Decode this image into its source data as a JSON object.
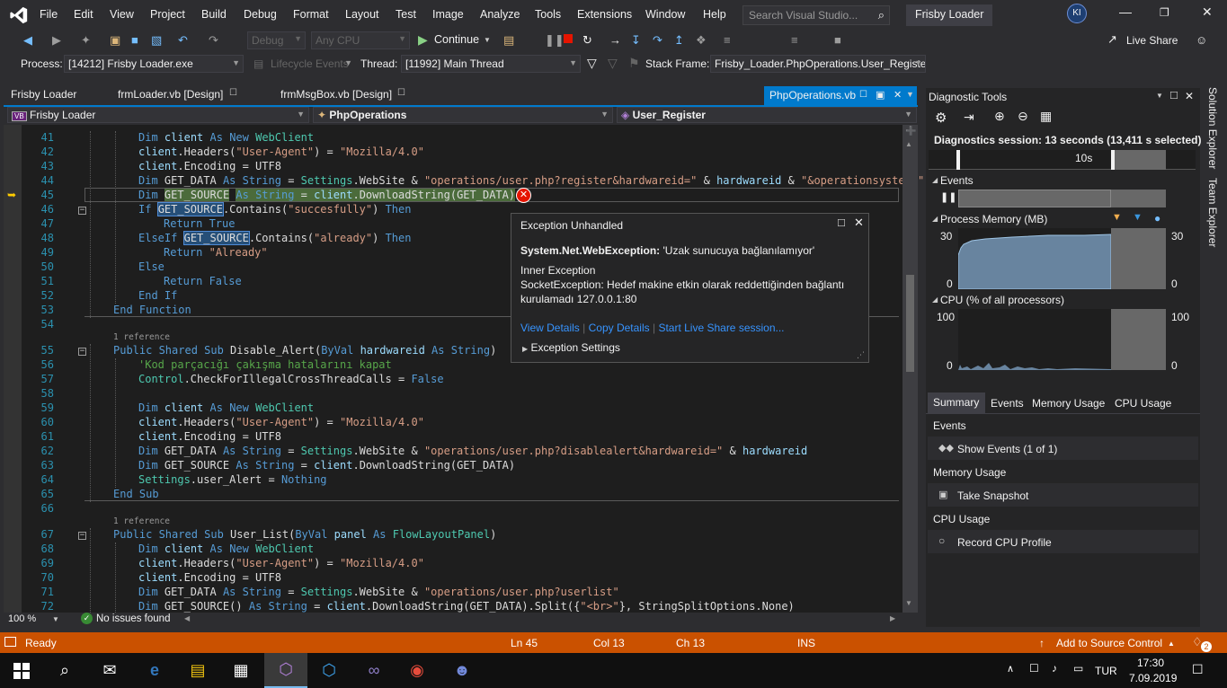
{
  "menu": {
    "items": [
      "File",
      "Edit",
      "View",
      "Project",
      "Build",
      "Debug",
      "Format",
      "Layout",
      "Test",
      "Image",
      "Analyze",
      "Tools",
      "Extensions",
      "Window",
      "Help"
    ],
    "search_placeholder": "Search Visual Studio...",
    "solution_title": "Frisby Loader",
    "user_initials": "KI"
  },
  "toolbar": {
    "config": "Debug",
    "platform": "Any CPU",
    "continue_label": "Continue",
    "live_share": "Live Share",
    "process_label": "Process:",
    "process_value": "[14212] Frisby Loader.exe",
    "lifecycle_label": "Lifecycle Events",
    "thread_label": "Thread:",
    "thread_value": "[11992] Main Thread",
    "stackframe_label": "Stack Frame:",
    "stackframe_value": "Frisby_Loader.PhpOperations.User_Registe"
  },
  "tabs": {
    "items": [
      "Frisby Loader",
      "frmLoader.vb [Design]",
      "frmMsgBox.vb [Design]"
    ],
    "active": "PhpOperations.vb"
  },
  "navbar": {
    "project": "Frisby Loader",
    "class": "PhpOperations",
    "member": "User_Register"
  },
  "editor": {
    "zoom": "100 %",
    "issues": "No issues found",
    "reference_label": "1 reference"
  },
  "exception": {
    "title": "Exception Unhandled",
    "type": "System.Net.WebException:",
    "message": "'Uzak sunucuya bağlanılamıyor'",
    "inner_header": "Inner Exception",
    "inner_line1": "SocketException: Hedef makine etkin olarak reddettiğinden bağlantı",
    "inner_line2": "kurulamadı 127.0.0.1:80",
    "view_details": "View Details",
    "copy_details": "Copy Details",
    "live_share_link": "Start Live Share session...",
    "settings": "Exception Settings"
  },
  "diagnostics": {
    "title": "Diagnostic Tools",
    "session": "Diagnostics session: 13 seconds (13,411 s selected)",
    "ruler_mark": "10s",
    "events_label": "Events",
    "process_memory_label": "Process Memory (MB)",
    "mem_max": "30",
    "mem_min": "0",
    "cpu_label": "CPU (% of all processors)",
    "cpu_max": "100",
    "cpu_min": "0",
    "tabs": [
      "Summary",
      "Events",
      "Memory Usage",
      "CPU Usage"
    ],
    "sections": {
      "events_title": "Events",
      "show_events": "Show Events (1 of 1)",
      "memory_title": "Memory Usage",
      "take_snapshot": "Take Snapshot",
      "cpu_title": "CPU Usage",
      "record_cpu": "Record CPU Profile"
    }
  },
  "side_tabs": [
    "Solution Explorer",
    "Team Explorer"
  ],
  "status": {
    "ready": "Ready",
    "ln": "Ln 45",
    "col": "Col 13",
    "ch": "Ch 13",
    "mode": "INS",
    "source_control": "Add to Source Control",
    "notifications": "2"
  },
  "taskbar": {
    "lang": "TUR",
    "time": "17:30",
    "date": "7.09.2019"
  }
}
